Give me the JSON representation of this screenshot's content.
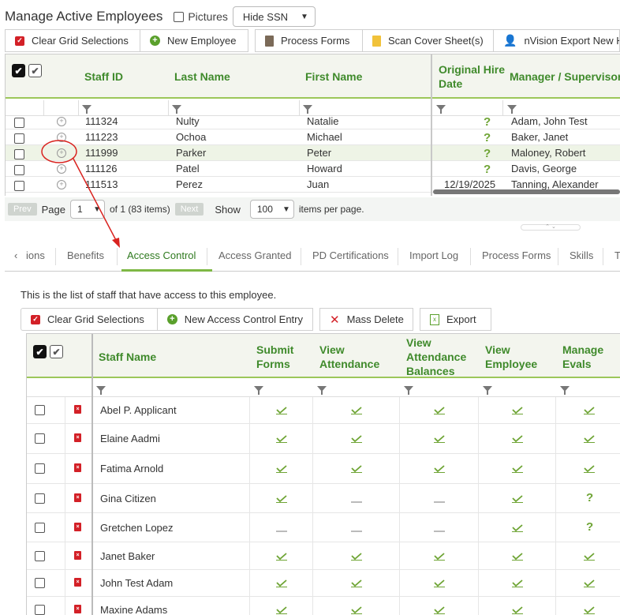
{
  "header": {
    "title": "Manage Active Employees",
    "pictures_label": "Pictures",
    "ssn_select": "Hide SSN"
  },
  "toolbar": {
    "clear": "Clear Grid Selections",
    "new_employee": "New Employee",
    "process_forms": "Process Forms",
    "scan_cover": "Scan Cover Sheet(s)",
    "nvision": "nVision Export New Hi"
  },
  "employee_grid": {
    "columns": [
      "Staff ID",
      "Last Name",
      "First Name",
      "Original Hire Date",
      "Manager / Supervisor"
    ],
    "rows": [
      {
        "id": "111324",
        "last": "Nulty",
        "first": "Natalie",
        "hire": "",
        "hire_icon": "?",
        "manager": "Adam, John Test"
      },
      {
        "id": "111223",
        "last": "Ochoa",
        "first": "Michael",
        "hire": "",
        "hire_icon": "?",
        "manager": "Baker, Janet"
      },
      {
        "id": "111999",
        "last": "Parker",
        "first": "Peter",
        "hire": "",
        "hire_icon": "?",
        "manager": "Maloney, Robert"
      },
      {
        "id": "111126",
        "last": "Patel",
        "first": "Howard",
        "hire": "",
        "hire_icon": "?",
        "manager": "Davis, George"
      },
      {
        "id": "111513",
        "last": "Perez",
        "first": "Juan",
        "hire": "12/19/2025",
        "hire_icon": "",
        "manager": "Tanning, Alexander"
      }
    ]
  },
  "pager": {
    "prev": "Prev",
    "page_label": "Page",
    "page_value": "1",
    "of_text": "of 1 (83 items)",
    "next": "Next",
    "show_label": "Show",
    "per_page_value": "100",
    "items_per_page": "items per page."
  },
  "tabs": {
    "scroll_left": "‹",
    "items": [
      "ions",
      "Benefits",
      "Access Control",
      "Access Granted",
      "PD Certifications",
      "Import Log",
      "Process Forms",
      "Skills",
      "T"
    ],
    "active_index": 2
  },
  "access": {
    "description": "This is the list of staff that have access to this employee.",
    "toolbar": {
      "clear": "Clear Grid Selections",
      "new_entry": "New Access Control Entry",
      "mass_delete": "Mass Delete",
      "export": "Export"
    },
    "columns": [
      "Staff Name",
      "Submit Forms",
      "View Attendance",
      "View Attendance Balances",
      "View Employee",
      "Manage Evals"
    ],
    "rows": [
      {
        "name": "Abel P. Applicant",
        "perms": [
          "check",
          "check",
          "check",
          "check",
          "check"
        ]
      },
      {
        "name": "Elaine Aadmi",
        "perms": [
          "check",
          "check",
          "check",
          "check",
          "check"
        ]
      },
      {
        "name": "Fatima Arnold",
        "perms": [
          "check",
          "check",
          "check",
          "check",
          "check"
        ]
      },
      {
        "name": "Gina Citizen",
        "perms": [
          "check",
          "dash",
          "dash",
          "check",
          "question"
        ]
      },
      {
        "name": "Gretchen Lopez",
        "perms": [
          "dash",
          "dash",
          "dash",
          "check",
          "question"
        ]
      },
      {
        "name": "Janet Baker",
        "perms": [
          "check",
          "check",
          "check",
          "check",
          "check"
        ]
      },
      {
        "name": "John Test Adam",
        "perms": [
          "check",
          "check",
          "check",
          "check",
          "check"
        ]
      },
      {
        "name": "Maxine Adams",
        "perms": [
          "check",
          "check",
          "check",
          "check",
          "check"
        ]
      }
    ]
  },
  "colors": {
    "accent_green": "#3f8a2b",
    "header_underline": "#9cc75a",
    "danger_red": "#d32027",
    "annotation_red": "#d9231f"
  }
}
